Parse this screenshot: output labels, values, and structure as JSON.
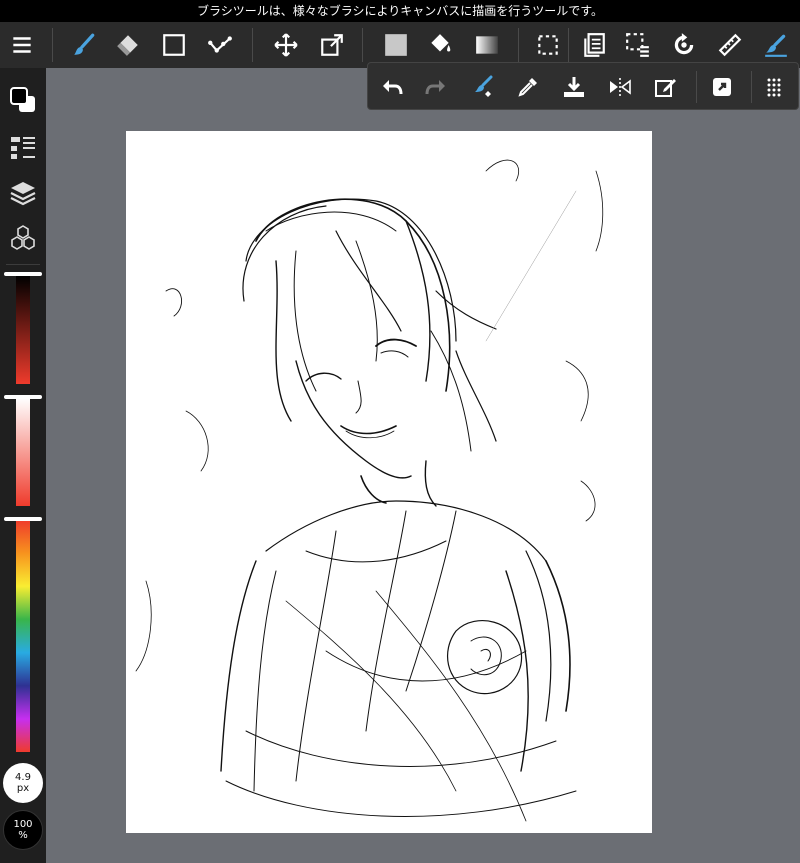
{
  "hint": {
    "text": "ブラシツールは、様々なブラシによりキャンバスに描画を行うツールです。"
  },
  "toolbar": {
    "items": [
      {
        "icon": "menu-icon"
      },
      {
        "icon": "brush-icon",
        "active": true
      },
      {
        "icon": "eraser-icon"
      },
      {
        "icon": "rectangle-icon"
      },
      {
        "icon": "dot-line-icon"
      },
      {
        "icon": "move-icon"
      },
      {
        "icon": "transform-icon"
      },
      {
        "icon": "fill-color-icon"
      },
      {
        "icon": "bucket-icon"
      },
      {
        "icon": "gradient-icon"
      },
      {
        "icon": "selection-icon"
      },
      {
        "icon": "copy-icon"
      },
      {
        "icon": "selection-list-icon"
      },
      {
        "icon": "rotate-icon"
      },
      {
        "icon": "ruler-icon"
      },
      {
        "icon": "brush-snap-icon"
      }
    ]
  },
  "subbar": {
    "items": [
      {
        "icon": "undo-icon"
      },
      {
        "icon": "redo-icon"
      },
      {
        "icon": "brush-settings-icon"
      },
      {
        "icon": "eyedropper-icon"
      },
      {
        "icon": "save-icon"
      },
      {
        "icon": "flip-icon"
      },
      {
        "icon": "edit-icon"
      },
      {
        "icon": "export-icon"
      },
      {
        "icon": "more-icon"
      }
    ]
  },
  "left": {
    "brush_size": {
      "value": "4.9",
      "unit": "px"
    },
    "zoom": {
      "value": "100",
      "unit": "%"
    },
    "opacity_level": 1.0,
    "brightness_level": 1.0,
    "hue_level": 0.0
  },
  "colors": {
    "accent": "#4aa3df",
    "toolbar_bg": "#2b2b2b",
    "panel_bg": "#1f1f1f",
    "workspace_bg": "#6b6e74"
  }
}
